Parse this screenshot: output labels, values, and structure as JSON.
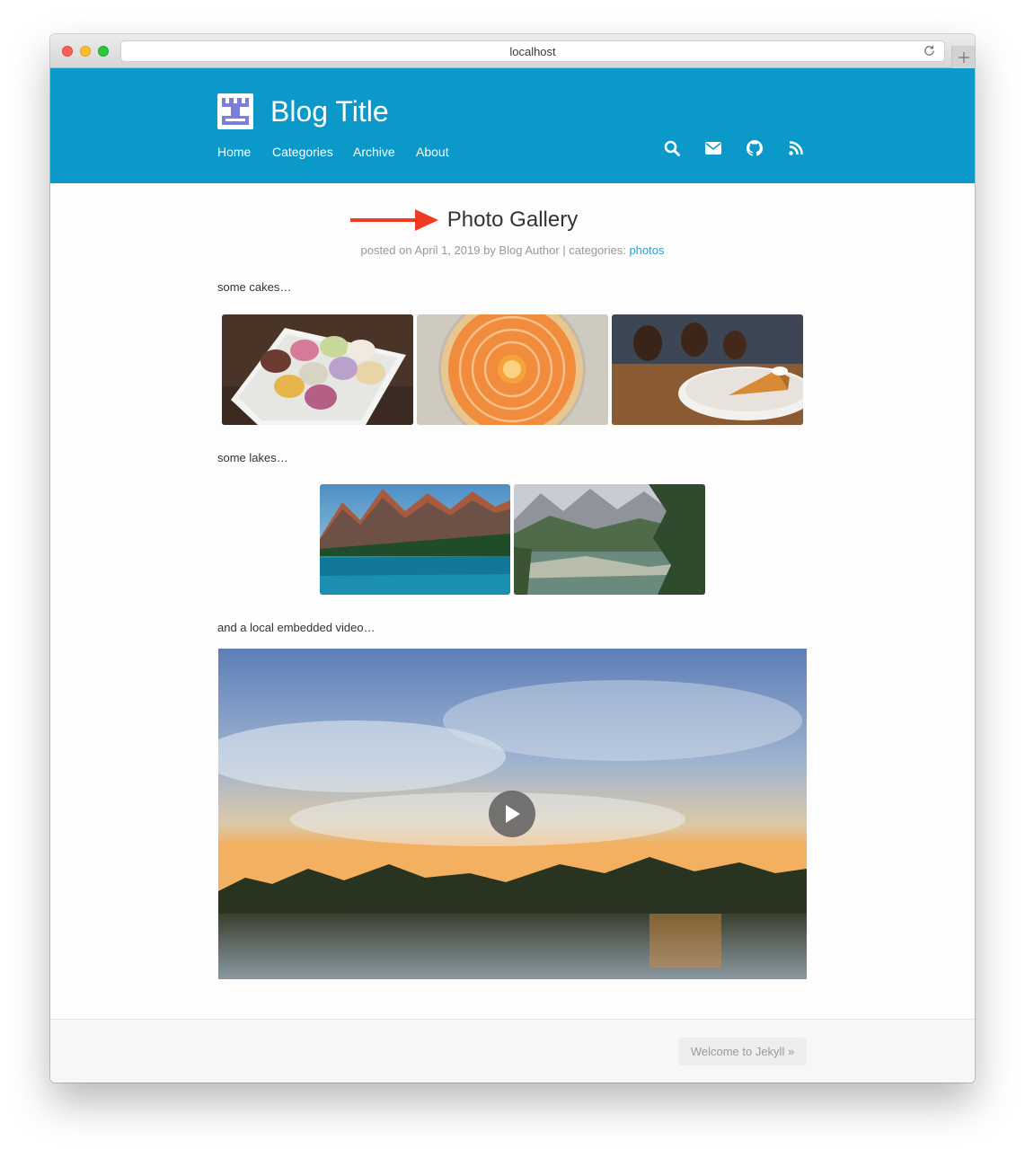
{
  "browser": {
    "url": "localhost"
  },
  "site": {
    "title": "Blog Title",
    "nav": [
      "Home",
      "Categories",
      "Archive",
      "About"
    ],
    "icons": [
      "search-icon",
      "mail-icon",
      "github-icon",
      "rss-icon"
    ],
    "header_color": "#0a99c9"
  },
  "post": {
    "title": "Photo Gallery",
    "meta_prefix": "posted on April 1, 2019 by Blog Author | categories: ",
    "category": "photos",
    "para_cakes": "some cakes…",
    "para_lakes": "some lakes…",
    "para_video": "and a local embedded video…"
  },
  "footer": {
    "next_label": "Welcome to Jekyll »"
  },
  "colors": {
    "link": "#2a9fd6",
    "annotation_arrow": "#f03a24"
  }
}
